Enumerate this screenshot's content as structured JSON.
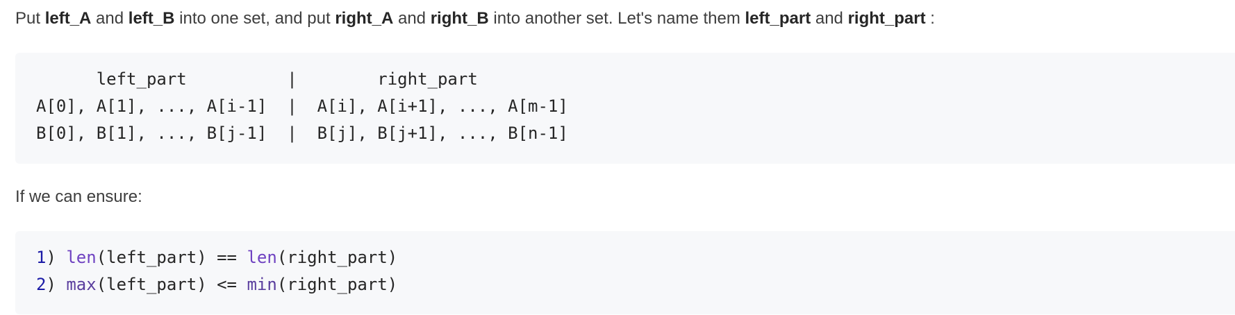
{
  "intro": {
    "t1": "Put ",
    "b1": "left_A",
    "t2": " and ",
    "b2": "left_B",
    "t3": " into one set, and put ",
    "b3": "right_A",
    "t4": " and ",
    "b4": "right_B",
    "t5": " into another set. Let's name them ",
    "b5": "left_part",
    "t6": " and ",
    "b6": "right_part",
    "t7": " :"
  },
  "partition_block": {
    "lines": [
      "      left_part          |        right_part",
      "A[0], A[1], ..., A[i-1]  |  A[i], A[i+1], ..., A[m-1]",
      "B[0], B[1], ..., B[j-1]  |  B[j], B[j+1], ..., B[n-1]"
    ]
  },
  "condition_intro": "If we can ensure:",
  "conditions_block": {
    "line1": {
      "num": "1",
      "paren": ") ",
      "fn1": "len",
      "arg1": "(left_part) == ",
      "fn2": "len",
      "arg2": "(right_part)"
    },
    "line2": {
      "num": "2",
      "paren": ") ",
      "fn1": "max",
      "arg1": "(left_part) <= ",
      "fn2": "min",
      "arg2": "(right_part)"
    }
  }
}
